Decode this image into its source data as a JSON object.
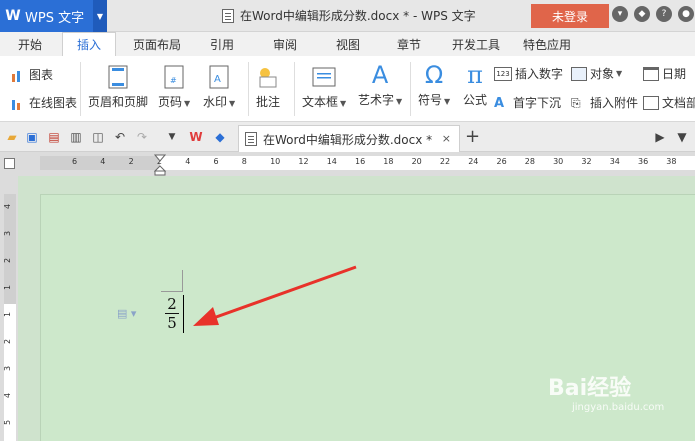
{
  "titlebar": {
    "app_name": "WPS 文字",
    "doc_title": "在Word中编辑形成分数.docx * - WPS 文字",
    "login_label": "未登录"
  },
  "menu": {
    "tabs": [
      "开始",
      "插入",
      "页面布局",
      "引用",
      "审阅",
      "视图",
      "章节",
      "开发工具",
      "特色应用"
    ],
    "active_tab": "插入"
  },
  "ribbon": {
    "chart": "图表",
    "online_chart": "在线图表",
    "header_footer": "页眉和页脚",
    "page_number": "页码",
    "watermark": "水印",
    "comment": "批注",
    "textbox": "文本框",
    "wordart": "艺术字",
    "symbol": "符号",
    "formula": "公式",
    "formula_glyph": "π",
    "symbol_glyph": "Ω",
    "wordart_glyph": "A",
    "insert_number": "插入数字",
    "insert_number_badge": "123",
    "object": "对象",
    "date": "日期",
    "drop_cap": "首字下沉",
    "attachment": "插入附件",
    "doc_parts": "文档部"
  },
  "doc_tab": {
    "title": "在Word中编辑形成分数.docx *",
    "close": "×",
    "new_tab": "+"
  },
  "ruler": {
    "h_numbers": [
      "6",
      "4",
      "2",
      "2",
      "4",
      "6",
      "8",
      "10",
      "12",
      "14",
      "16",
      "18",
      "20",
      "22",
      "24",
      "26",
      "28",
      "30",
      "32",
      "34",
      "36",
      "38"
    ],
    "v_numbers": [
      "4",
      "3",
      "2",
      "1",
      "1",
      "2",
      "3",
      "4",
      "5",
      "6"
    ]
  },
  "document": {
    "numerator": "2",
    "denominator": "5"
  },
  "watermark": {
    "brand": "Bai经验",
    "url": "jingyan.baidu.com"
  },
  "colors": {
    "wps_blue": "#2b6fd6",
    "login_red": "#e0654a",
    "page_green": "#cde8cb",
    "arrow_red": "#e8322a"
  }
}
